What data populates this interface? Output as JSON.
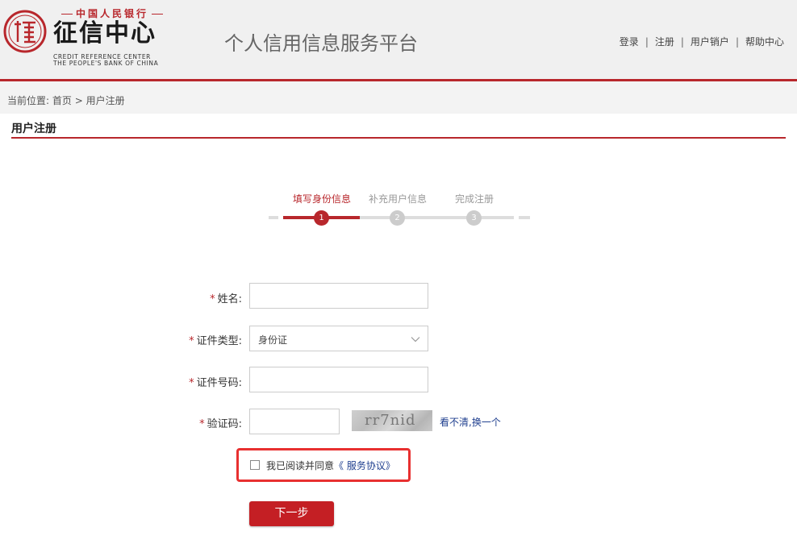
{
  "header": {
    "brand_top": "中国人民银行",
    "brand_main": "征信中心",
    "brand_en_line1": "CREDIT REFERENCE CENTER",
    "brand_en_line2": "THE PEOPLE'S BANK OF CHINA",
    "platform_title": "个人信用信息服务平台",
    "nav": [
      {
        "label": "登录"
      },
      {
        "label": "注册"
      },
      {
        "label": "用户销户"
      },
      {
        "label": "帮助中心"
      }
    ],
    "nav_separator": "|"
  },
  "breadcrumb": {
    "prefix": "当前位置:",
    "home": "首页",
    "separator": ">",
    "current": "用户注册"
  },
  "section": {
    "title": "用户注册"
  },
  "steps": [
    {
      "label": "填写身份信息",
      "number": "1",
      "active": true
    },
    {
      "label": "补充用户信息",
      "number": "2",
      "active": false
    },
    {
      "label": "完成注册",
      "number": "3",
      "active": false
    }
  ],
  "form": {
    "required_mark": "*",
    "name_label": "姓名:",
    "name_value": "",
    "id_type_label": "证件类型:",
    "id_type_value": "身份证",
    "id_number_label": "证件号码:",
    "id_number_value": "",
    "captcha_label": "验证码:",
    "captcha_value": "",
    "captcha_code": "rr7nid",
    "captcha_unclear": "看不清,",
    "captcha_refresh": "换一个",
    "agree_text": "我已阅读并同意",
    "agree_link": "《 服务协议》",
    "agree_checked": false,
    "next_button": "下一步"
  },
  "colors": {
    "brand_red": "#b8272c",
    "button_red": "#c41f24",
    "highlight_red": "#e83030",
    "link_blue": "#1f3f8f"
  }
}
